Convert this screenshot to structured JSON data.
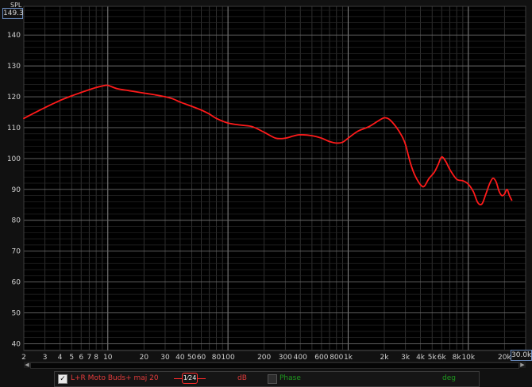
{
  "chart_data": {
    "type": "line",
    "y_unit": "SPL",
    "ylim": [
      37.8,
      149.3
    ],
    "y_max_label": "149.3",
    "y_ticks": [
      40,
      50,
      60,
      70,
      80,
      90,
      100,
      110,
      120,
      130,
      140
    ],
    "x_scale": "log",
    "xlim": [
      2,
      30000
    ],
    "x_max_label": "30.0k",
    "x_ticks": [
      {
        "v": 2,
        "l": "2"
      },
      {
        "v": 3,
        "l": "3"
      },
      {
        "v": 4,
        "l": "4"
      },
      {
        "v": 5,
        "l": "5"
      },
      {
        "v": 6,
        "l": "6"
      },
      {
        "v": 7,
        "l": "7"
      },
      {
        "v": 8,
        "l": "8"
      },
      {
        "v": 10,
        "l": "10"
      },
      {
        "v": 20,
        "l": "20"
      },
      {
        "v": 30,
        "l": "30"
      },
      {
        "v": 40,
        "l": "40"
      },
      {
        "v": 50,
        "l": "50"
      },
      {
        "v": 60,
        "l": "60"
      },
      {
        "v": 80,
        "l": "80"
      },
      {
        "v": 100,
        "l": "100"
      },
      {
        "v": 200,
        "l": "200"
      },
      {
        "v": 300,
        "l": "300"
      },
      {
        "v": 400,
        "l": "400"
      },
      {
        "v": 600,
        "l": "600"
      },
      {
        "v": 800,
        "l": "800"
      },
      {
        "v": 1000,
        "l": "1k"
      },
      {
        "v": 2000,
        "l": "2k"
      },
      {
        "v": 3000,
        "l": "3k"
      },
      {
        "v": 4000,
        "l": "4k"
      },
      {
        "v": 5000,
        "l": "5k"
      },
      {
        "v": 6000,
        "l": "6k"
      },
      {
        "v": 8000,
        "l": "8k"
      },
      {
        "v": 10000,
        "l": "10k"
      },
      {
        "v": 20000,
        "l": "20k"
      }
    ],
    "grid": true,
    "series": [
      {
        "name": "L+R Moto Buds+ maj 20",
        "color": "#ff1a1a",
        "points": [
          [
            2,
            113
          ],
          [
            3,
            116.5
          ],
          [
            4,
            118.8
          ],
          [
            5,
            120.3
          ],
          [
            6,
            121.4
          ],
          [
            7,
            122.3
          ],
          [
            8,
            123
          ],
          [
            9,
            123.5
          ],
          [
            10,
            123.7
          ],
          [
            12,
            122.6
          ],
          [
            15,
            122
          ],
          [
            20,
            121.2
          ],
          [
            25,
            120.6
          ],
          [
            30,
            120
          ],
          [
            35,
            119.3
          ],
          [
            40,
            118.3
          ],
          [
            50,
            116.9
          ],
          [
            60,
            115.7
          ],
          [
            70,
            114.4
          ],
          [
            80,
            113
          ],
          [
            100,
            111.5
          ],
          [
            130,
            110.8
          ],
          [
            160,
            110.3
          ],
          [
            200,
            108.5
          ],
          [
            250,
            106.6
          ],
          [
            300,
            106.6
          ],
          [
            350,
            107.3
          ],
          [
            400,
            107.7
          ],
          [
            500,
            107.4
          ],
          [
            600,
            106.6
          ],
          [
            700,
            105.5
          ],
          [
            800,
            105
          ],
          [
            900,
            105.3
          ],
          [
            1000,
            106.6
          ],
          [
            1200,
            108.8
          ],
          [
            1500,
            110.4
          ],
          [
            1800,
            112.3
          ],
          [
            2000,
            113.2
          ],
          [
            2200,
            112.7
          ],
          [
            2500,
            110.3
          ],
          [
            2800,
            107.3
          ],
          [
            3000,
            104.5
          ],
          [
            3300,
            98.5
          ],
          [
            3600,
            94.5
          ],
          [
            4000,
            91.5
          ],
          [
            4300,
            91
          ],
          [
            4700,
            93.5
          ],
          [
            5200,
            95.5
          ],
          [
            5600,
            98
          ],
          [
            6000,
            100.5
          ],
          [
            6500,
            99
          ],
          [
            7000,
            96.5
          ],
          [
            8000,
            93.3
          ],
          [
            9000,
            92.8
          ],
          [
            10000,
            91.7
          ],
          [
            11000,
            89.3
          ],
          [
            12000,
            85.7
          ],
          [
            13000,
            85.3
          ],
          [
            14000,
            88.5
          ],
          [
            15000,
            91.7
          ],
          [
            16000,
            93.6
          ],
          [
            17000,
            92.5
          ],
          [
            18000,
            89.5
          ],
          [
            19000,
            88
          ],
          [
            20000,
            88.5
          ],
          [
            21000,
            90
          ],
          [
            22000,
            88
          ],
          [
            23000,
            86.5
          ]
        ]
      }
    ]
  },
  "legend": {
    "series_label": "L+R Moto Buds+ maj 20",
    "smoothing_num": "1",
    "smoothing_den": "24",
    "unit_left": "dB",
    "phase_label": "Phase",
    "unit_right": "deg",
    "checkbox_mark": "✓"
  },
  "scroll": {
    "left_arrow": "◀",
    "right_arrow": "▶"
  }
}
